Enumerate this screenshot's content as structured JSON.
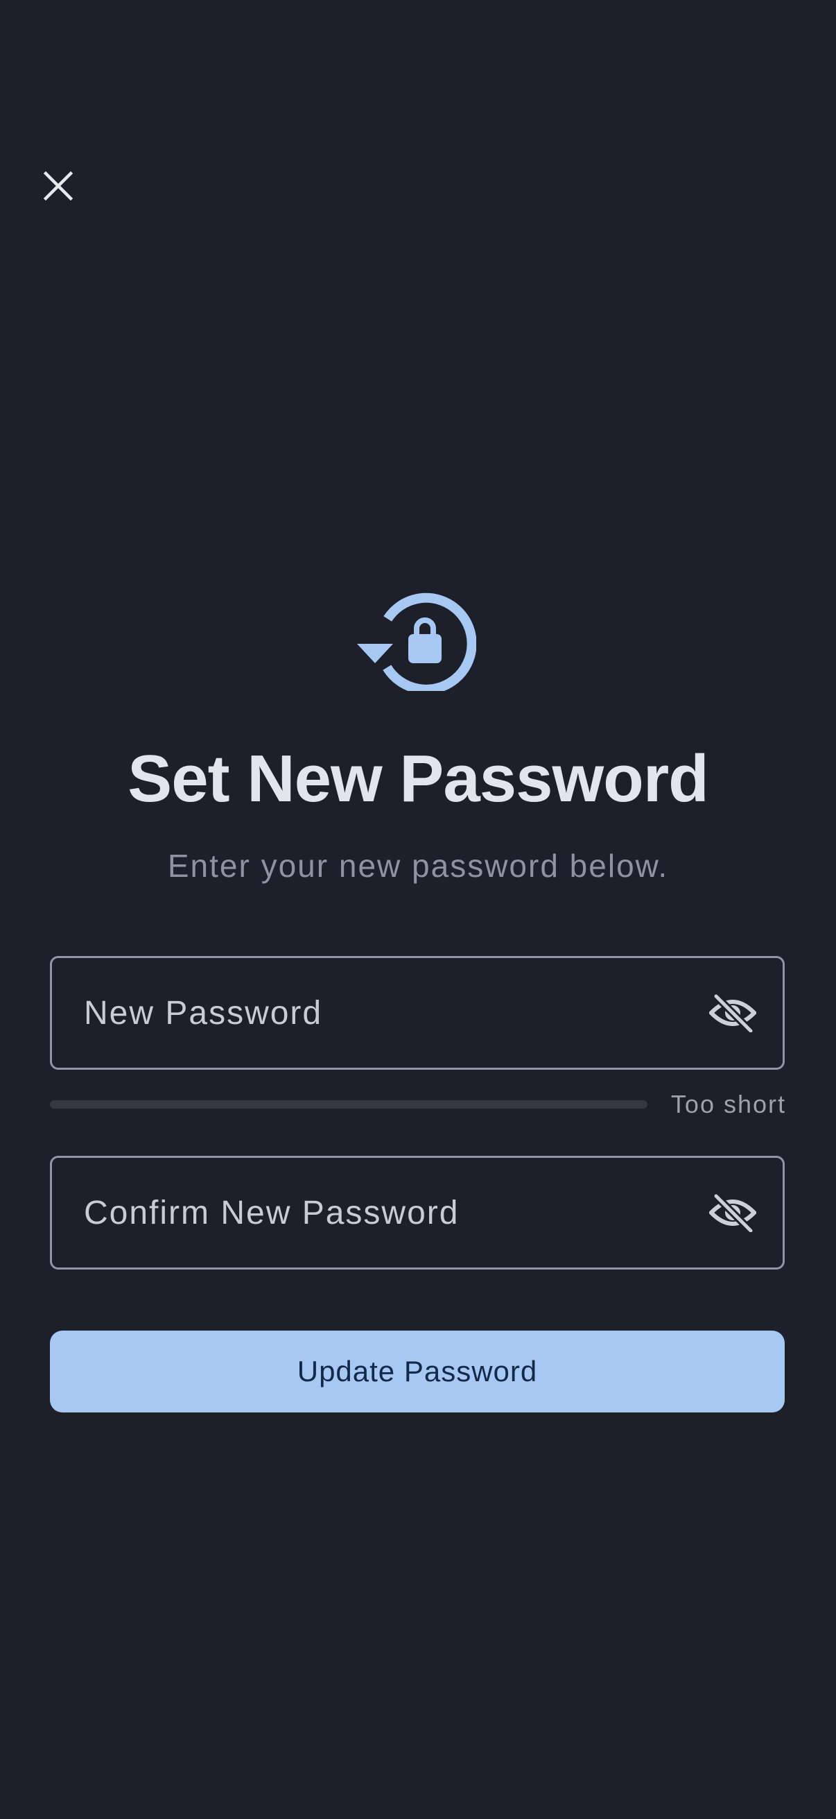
{
  "header": {
    "close_icon": "close-icon"
  },
  "hero": {
    "icon": "lock-reset-icon",
    "title": "Set New Password",
    "subtitle": "Enter your new password below."
  },
  "form": {
    "new_password": {
      "label": "New Password",
      "value": "",
      "visibility_icon": "eye-off-icon"
    },
    "strength": {
      "label": "Too short",
      "level": 0
    },
    "confirm_password": {
      "label": "Confirm New Password",
      "value": "",
      "visibility_icon": "eye-off-icon"
    },
    "submit_label": "Update Password"
  },
  "colors": {
    "background": "#1d202b",
    "accent": "#a6c8f2",
    "button_text": "#13294a",
    "field_border": "#9097a3"
  }
}
